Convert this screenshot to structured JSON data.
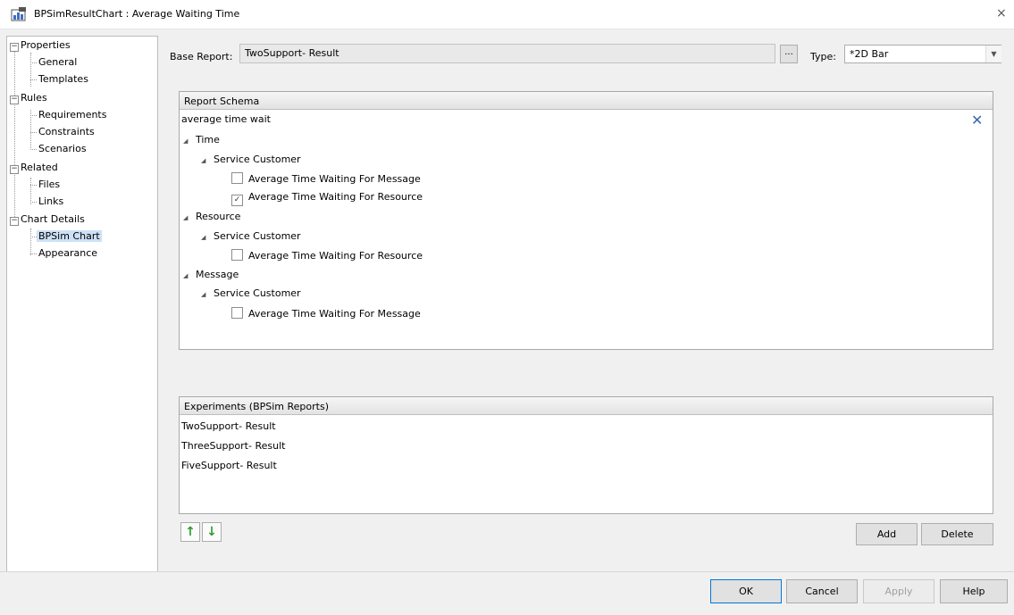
{
  "window": {
    "title": "BPSimResultChart : Average Waiting Time",
    "close": "×"
  },
  "tree": {
    "properties": "Properties",
    "general": "General",
    "templates": "Templates",
    "rules": "Rules",
    "requirements": "Requirements",
    "constraints": "Constraints",
    "scenarios": "Scenarios",
    "related": "Related",
    "files": "Files",
    "links": "Links",
    "chart_details": "Chart Details",
    "bpsim_chart": "BPSim Chart",
    "appearance": "Appearance"
  },
  "form": {
    "base_report_label": "Base Report:",
    "base_report_value": "TwoSupport- Result",
    "browse": "...",
    "type_label": "Type:",
    "type_value": "*2D Bar"
  },
  "schema": {
    "header": "Report Schema",
    "filter": "average time wait",
    "time": "Time",
    "time_service_customer": "Service Customer",
    "time_msg": "Average Time Waiting For Message",
    "time_msg_checked": false,
    "time_res": "Average Time Waiting For Resource",
    "time_res_checked": true,
    "resource": "Resource",
    "resource_service_customer": "Service Customer",
    "resource_res": "Average Time Waiting For Resource",
    "resource_res_checked": false,
    "message": "Message",
    "message_service_customer": "Service Customer",
    "message_msg": "Average Time Waiting For Message",
    "message_msg_checked": false
  },
  "experiments": {
    "header": "Experiments (BPSim Reports)",
    "rows": [
      "TwoSupport- Result",
      "ThreeSupport- Result",
      "FiveSupport- Result"
    ]
  },
  "buttons": {
    "add": "Add",
    "delete": "Delete",
    "ok": "OK",
    "cancel": "Cancel",
    "apply": "Apply",
    "help": "Help"
  }
}
